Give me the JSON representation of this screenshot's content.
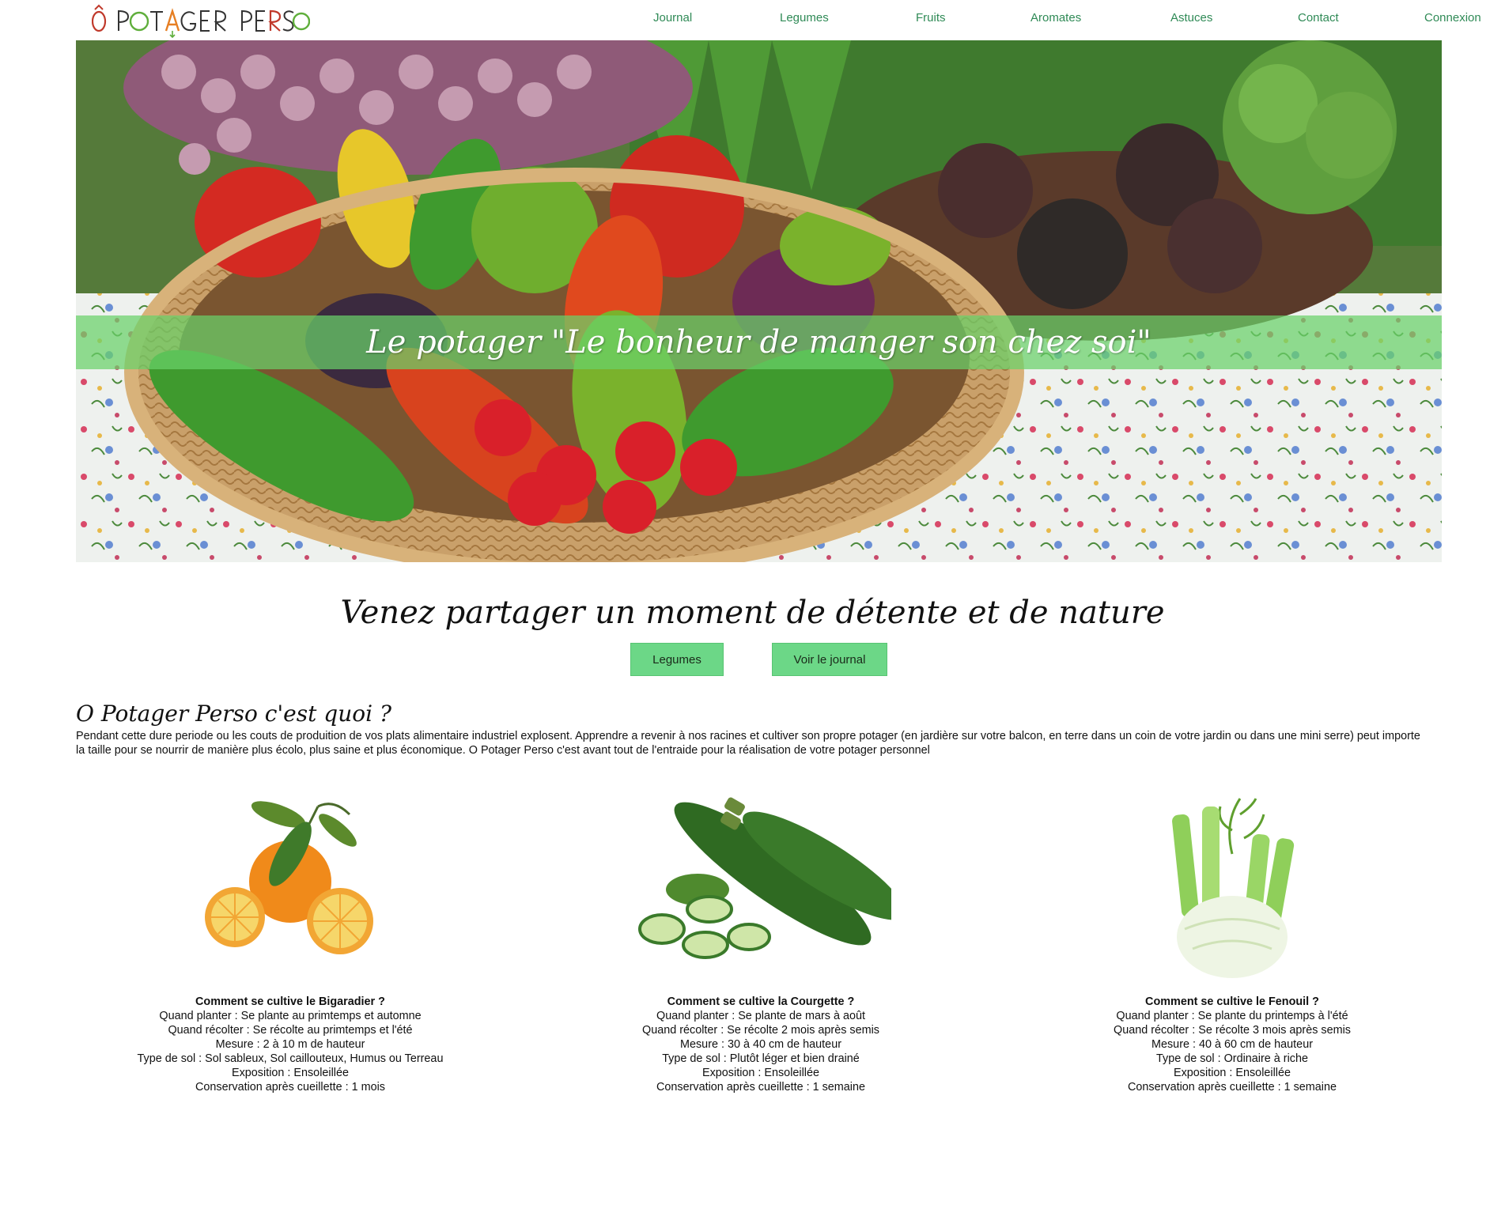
{
  "header": {
    "logo": "Ô POTAGER PERSO",
    "nav": [
      {
        "label": "Journal"
      },
      {
        "label": "Legumes"
      },
      {
        "label": "Fruits"
      },
      {
        "label": "Aromates"
      },
      {
        "label": "Astuces"
      },
      {
        "label": "Contact"
      },
      {
        "label": "Connexion"
      }
    ]
  },
  "hero": {
    "band_text": "Le potager \"Le bonheur de manger son chez soi\""
  },
  "tagline": "Venez partager un moment de détente et de nature",
  "buttons": {
    "legumes": "Legumes",
    "journal": "Voir le journal"
  },
  "about": {
    "title": "O Potager Perso c'est quoi ?",
    "text": "Pendant cette dure periode ou les couts de produition de vos plats alimentaire industriel explosent. Apprendre a revenir à nos racines et cultiver son propre potager (en jardière sur votre balcon, en terre dans un coin de votre jardin ou dans une mini serre) peut importe la taille pour se nourrir de manière plus écolo, plus saine et plus économique. O Potager Perso c'est avant tout de l'entraide pour la réalisation de votre potager personnel"
  },
  "cards": [
    {
      "icon": "bigaradier-orange-image",
      "title": "Comment se cultive le Bigaradier ?",
      "lines": [
        "Quand planter : Se plante au primtemps et automne",
        "Quand récolter : Se récolte au primtemps et l'été",
        "Mesure : 2 à 10 m de hauteur",
        "Type de sol : Sol sableux, Sol caillouteux, Humus ou Terreau",
        "Exposition : Ensoleillée",
        "Conservation après cueillette : 1 mois"
      ]
    },
    {
      "icon": "courgette-image",
      "title": "Comment se cultive la Courgette ?",
      "lines": [
        "Quand planter : Se plante de mars à août",
        "Quand récolter : Se récolte 2 mois après semis",
        "Mesure : 30 à 40 cm de hauteur",
        "Type de sol : Plutôt léger et bien drainé",
        "Exposition : Ensoleillée",
        "Conservation après cueillette : 1 semaine"
      ]
    },
    {
      "icon": "fenouil-image",
      "title": "Comment se cultive le Fenouil ?",
      "lines": [
        "Quand planter : Se plante du printemps à l'été",
        "Quand récolter : Se récolte 3 mois après semis",
        "Mesure : 40 à 60 cm de hauteur",
        "Type de sol : Ordinaire à riche",
        "Exposition : Ensoleillée",
        "Conservation après cueillette : 1 semaine"
      ]
    }
  ],
  "colors": {
    "nav": "#2f8a56",
    "button": "#6cd787",
    "band": "#6ad16a"
  }
}
